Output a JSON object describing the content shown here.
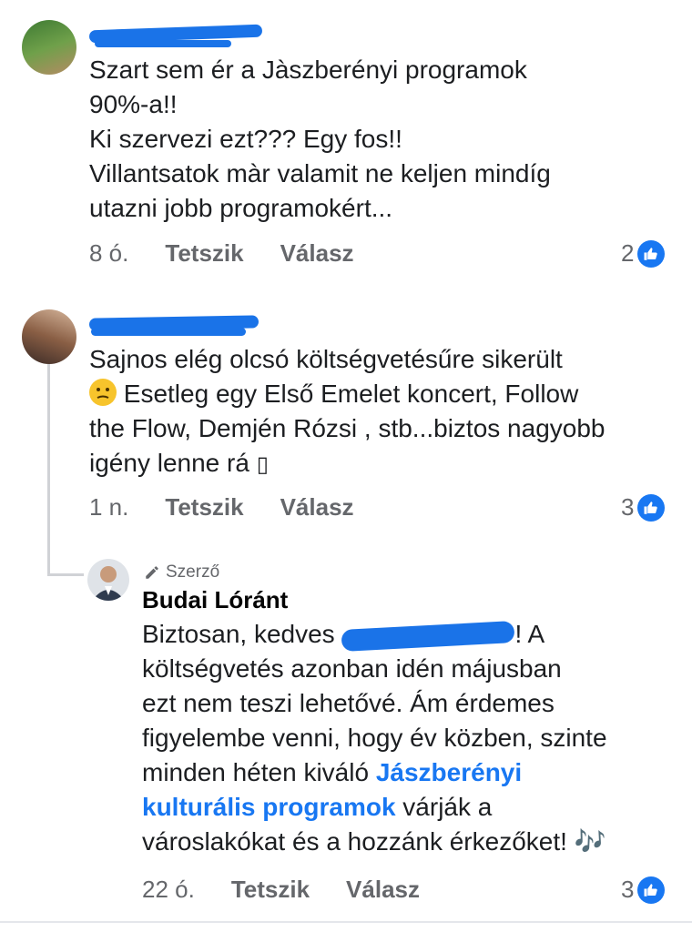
{
  "comments": [
    {
      "text_lines": [
        "Szart sem ér a Jàszberényi programok",
        "90%-a!!",
        "Ki szervezi ezt??? Egy fos!!",
        "Villantsatok màr valamit ne keljen mindíg",
        "utazni jobb programokért..."
      ],
      "time": "8 ó.",
      "like_label": "Tetszik",
      "reply_label": "Válasz",
      "like_count": "2"
    },
    {
      "text_line_1": "Sajnos elég olcsó költségvetésűre sikerült",
      "text_line_2": "Esetleg egy Első Emelet koncert, Follow",
      "text_line_3": "the Flow, Demjén Rózsi , stb...biztos nagyobb",
      "text_line_4": "igény lenne rá",
      "text_line_4_glyph": "▯",
      "time": "1 n.",
      "like_label": "Tetszik",
      "reply_label": "Válasz",
      "like_count": "3"
    }
  ],
  "reply": {
    "author_tag": "Szerző",
    "author_name": "Budai Lóránt",
    "line1_prefix": "Biztosan, kedves",
    "line1_suffix": "! A",
    "line2": "költségvetés azonban idén májusban",
    "line3": "ezt nem teszi lehetővé. Ám érdemes",
    "line4": "figyelembe venni, hogy év közben, szinte",
    "line5_prefix": "minden héten kiváló",
    "link_part1": "Jászberényi",
    "link_part2": "kulturális programok",
    "line6_suffix": "várják a",
    "line7": "városlakókat és a hozzánk érkezőket!",
    "line7_emoji": "🎶",
    "time": "22 ó.",
    "like_label": "Tetszik",
    "reply_label": "Válasz",
    "like_count": "3"
  },
  "colors": {
    "accent": "#1877f2",
    "redaction": "#1a73e8",
    "meta_text": "#65676b"
  },
  "icons": {
    "like": "thumbs-up-icon",
    "author": "pencil-icon"
  }
}
